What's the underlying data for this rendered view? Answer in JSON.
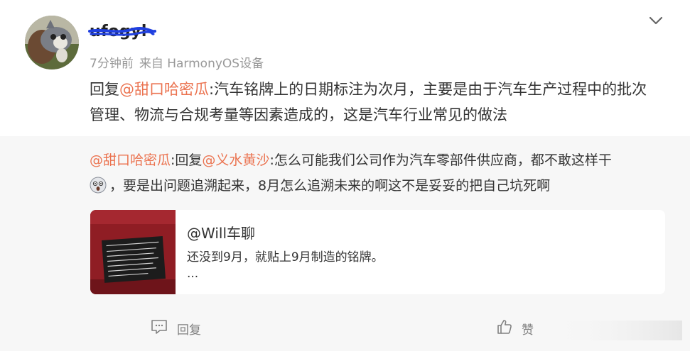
{
  "post": {
    "username": "ufogyl",
    "time": "7分钟前",
    "source": "来自 HarmonyOS设备",
    "reply_prefix": "回复",
    "reply_mention": "@甜口哈密瓜",
    "reply_text": ":汽车铭牌上的日期标注为次月，主要是由于汽车生产过程中的批次管理、物流与合规考量等因素造成的，这是汽车行业常见的做法"
  },
  "quote": {
    "author_mention": "@甜口哈密瓜",
    "reply_prefix": ":回复",
    "target_mention": "@义水黄沙",
    "text_part1": ":怎么可能我们公司作为汽车零部件供应商，都不敢这样干",
    "text_part2": "，要是出问题追溯起来，8月怎么追溯未来的啊这不是妥妥的把自己坑死啊",
    "embed": {
      "title": "@Will车聊",
      "text": "还没到9月，就贴上9月制造的铭牌。",
      "more": "..."
    }
  },
  "actions": {
    "reply_label": "回复",
    "like_label": "赞"
  },
  "colors": {
    "mention": "#eb7350",
    "muted": "#999999"
  },
  "icons": [
    "chevron-down-icon",
    "comment-icon",
    "thumbs-up-icon"
  ]
}
